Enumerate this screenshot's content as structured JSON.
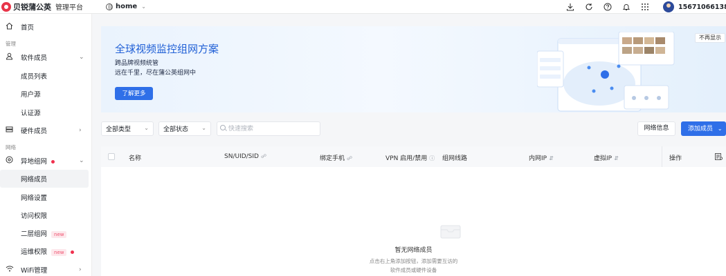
{
  "brand": {
    "name": "贝锐蒲公英",
    "subtitle": "管理平台",
    "logo_color": "#e8354a"
  },
  "header": {
    "env_label": "home",
    "user_phone": "15671066138",
    "icons": [
      "download-icon",
      "refresh-icon",
      "help-icon",
      "bell-icon",
      "apps-grid-icon"
    ]
  },
  "sidebar": {
    "home": "首页",
    "section_manage": "管理",
    "software_members": "软件成员",
    "member_list": "成员列表",
    "user_source": "用户源",
    "auth_source": "认证源",
    "hardware_members": "硬件成员",
    "section_network": "网络",
    "remote_network": "异地组网",
    "network_members": "网络成员",
    "network_settings": "网络设置",
    "access_rights": "访问权限",
    "layer2_network": "二层组网",
    "ops_rights": "运维权限",
    "wifi_manage": "WiFi管理",
    "new_badge": "new"
  },
  "banner": {
    "title": "全球视频监控组网方案",
    "subtitle1": "跨品牌视频统管",
    "subtitle2": "远在千里，尽在蒲公英组网中",
    "cta": "了解更多",
    "dismiss": "不再显示"
  },
  "toolbar": {
    "type_filter": "全部类型",
    "status_filter": "全部状态",
    "search_placeholder": "快速搜索",
    "network_info": "网络信息",
    "add_member": "添加成员"
  },
  "table": {
    "columns": {
      "name": "名称",
      "sn": "SN/UID/SID",
      "phone": "绑定手机",
      "vpn": "VPN 启用/禁用",
      "route": "组网线路",
      "lan_ip": "内网IP",
      "virtual_ip": "虚拟IP",
      "action": "操作"
    },
    "empty_title": "暂无网络成员",
    "empty_desc1": "点击右上角添加按钮，添加需要互访的",
    "empty_desc2": "软件成员或硬件设备"
  },
  "colors": {
    "accent": "#2f6fe8",
    "badge_red": "#f0304e"
  }
}
